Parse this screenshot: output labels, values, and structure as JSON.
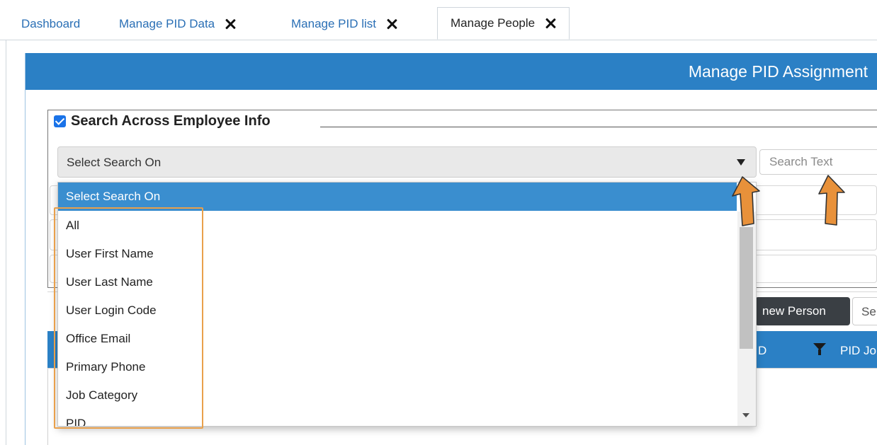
{
  "tabs": [
    {
      "label": "Dashboard",
      "closable": false,
      "active": false
    },
    {
      "label": "Manage PID Data",
      "closable": true,
      "active": false
    },
    {
      "label": "Manage PID list",
      "closable": true,
      "active": false
    },
    {
      "label": "Manage People",
      "closable": true,
      "active": true
    }
  ],
  "panel": {
    "title": "Manage PID Assignment"
  },
  "search": {
    "legend": "Search Across Employee Info",
    "checked": true,
    "select_value": "Select Search On",
    "text_placeholder": "Search Text",
    "options": [
      "Select Search On",
      "All",
      "User First Name",
      "User Last Name",
      "User Login Code",
      "Office Email",
      "Primary Phone",
      "Job Category",
      "PID"
    ]
  },
  "toolbar": {
    "new_person_label": "new Person",
    "search_partial": "Se"
  },
  "grid": {
    "col1": "D",
    "col2": "PID Jo"
  },
  "colors": {
    "accent": "#2b80c5",
    "selected": "#3a8ecf",
    "highlight": "#e9a04b",
    "arrow": "#e8913a"
  }
}
